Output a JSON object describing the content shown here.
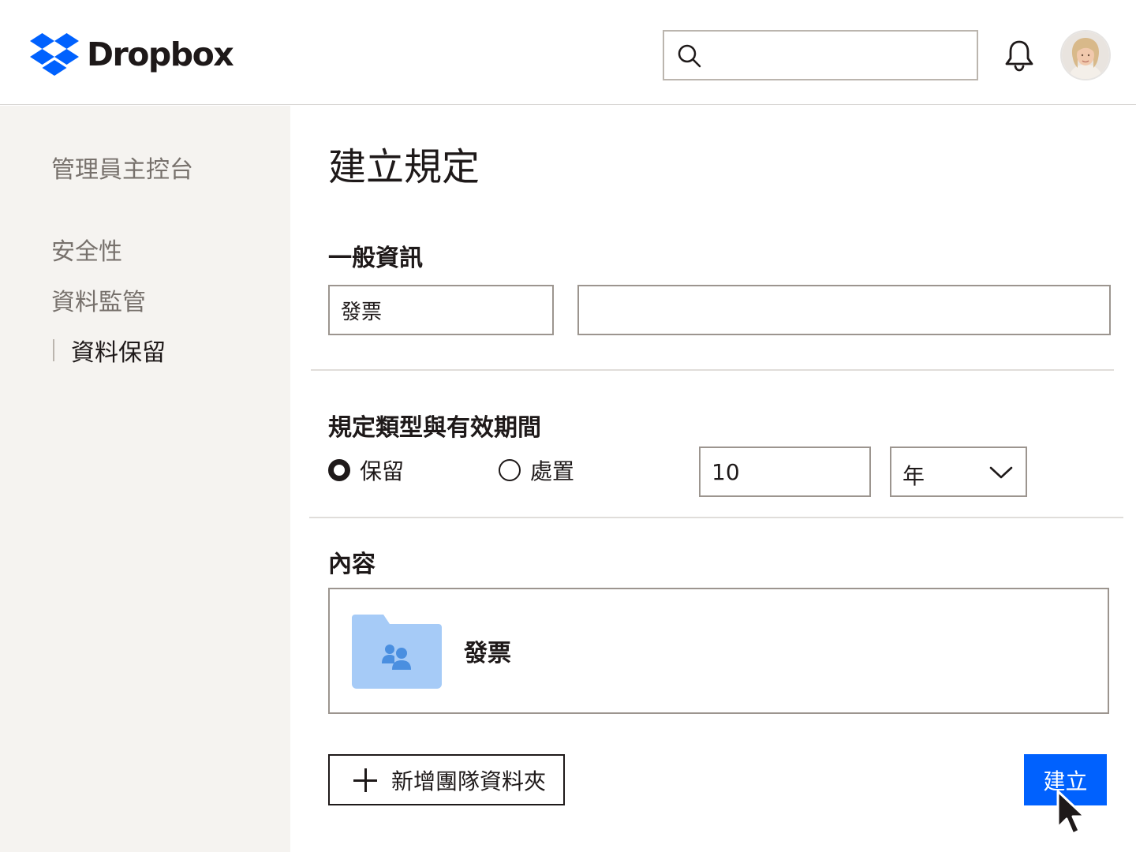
{
  "header": {
    "brand": "Dropbox",
    "search": {
      "placeholder": "",
      "value": ""
    }
  },
  "sidebar": {
    "console": "管理員主控台",
    "items": [
      {
        "label": "安全性"
      },
      {
        "label": "資料監管"
      },
      {
        "label": "資料保留",
        "active": true
      }
    ]
  },
  "main": {
    "title": "建立規定",
    "general": {
      "heading": "一般資訊",
      "name_value": "發票",
      "description_value": ""
    },
    "policy": {
      "heading": "規定類型與有效期間",
      "options": [
        {
          "label": "保留",
          "checked": true
        },
        {
          "label": "處置",
          "checked": false
        }
      ],
      "duration_value": "10",
      "unit_value": "年"
    },
    "content": {
      "heading": "內容",
      "folder_name": "發票",
      "folder_icon": "team-folder-icon"
    },
    "add_button": "新增團隊資料夾",
    "create_button": "建立"
  },
  "colors": {
    "accent": "#0061fe",
    "sidebar_bg": "#f5f3f0",
    "text": "#1e1919",
    "muted": "#77716c",
    "folder": "#a6cbf7"
  }
}
